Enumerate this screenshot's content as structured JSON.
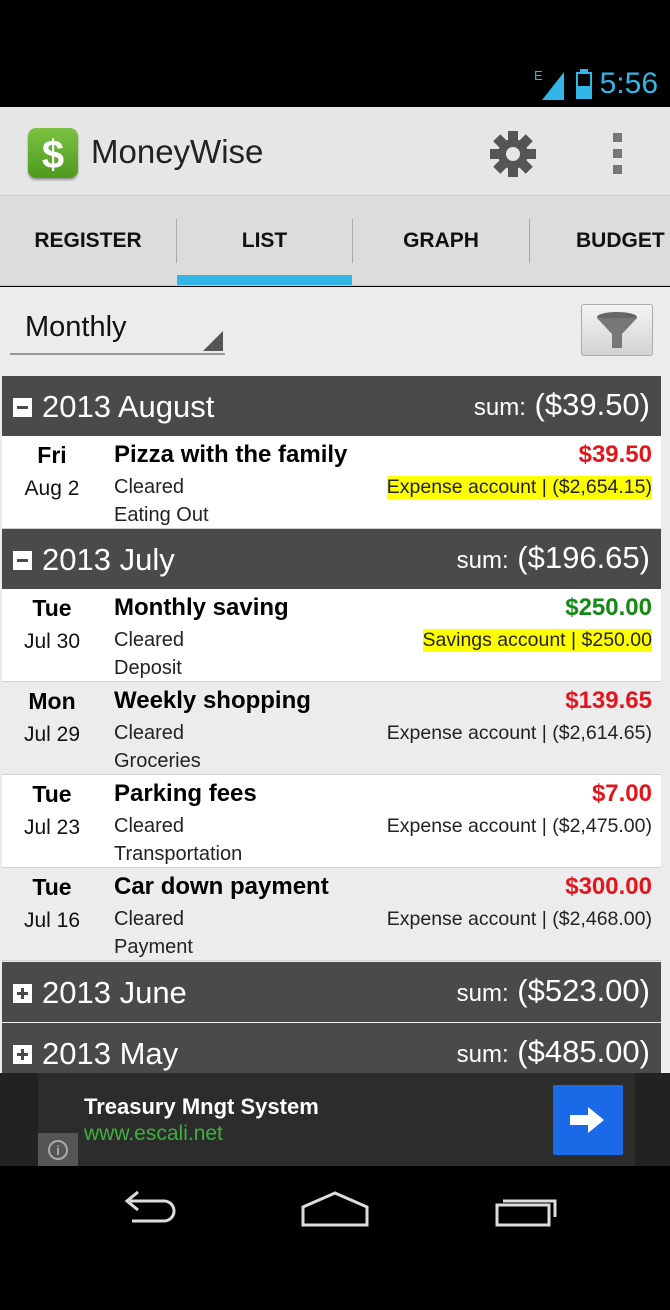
{
  "status_bar": {
    "network_type": "E",
    "time": "5:56"
  },
  "action_bar": {
    "app_title": "MoneyWise",
    "logo_glyph": "$"
  },
  "tabs": [
    {
      "label": "REGISTER",
      "selected": false
    },
    {
      "label": "LIST",
      "selected": true
    },
    {
      "label": "GRAPH",
      "selected": false
    },
    {
      "label": "BUDGET",
      "selected": false
    }
  ],
  "filter": {
    "period": "Monthly"
  },
  "groups": [
    {
      "title": "2013 August",
      "sum_label": "sum:",
      "sum": "($39.50)",
      "expanded": true,
      "transactions": [
        {
          "day": "Fri",
          "date": "Aug 2",
          "title": "Pizza with the family",
          "status": "Cleared",
          "category": "Eating Out",
          "amount": "$39.50",
          "amount_color": "#e4161d",
          "account": "Expense account | ($2,654.15)",
          "highlighted": true
        }
      ]
    },
    {
      "title": "2013 July",
      "sum_label": "sum:",
      "sum": "($196.65)",
      "expanded": true,
      "transactions": [
        {
          "day": "Tue",
          "date": "Jul 30",
          "title": "Monthly saving",
          "status": "Cleared",
          "category": "Deposit",
          "amount": "$250.00",
          "amount_color": "#138a13",
          "account": "Savings account | $250.00",
          "highlighted": true
        },
        {
          "day": "Mon",
          "date": "Jul 29",
          "title": "Weekly shopping",
          "status": "Cleared",
          "category": "Groceries",
          "amount": "$139.65",
          "amount_color": "#e4161d",
          "account": "Expense account | ($2,614.65)",
          "highlighted": false
        },
        {
          "day": "Tue",
          "date": "Jul 23",
          "title": "Parking fees",
          "status": "Cleared",
          "category": "Transportation",
          "amount": "$7.00",
          "amount_color": "#e4161d",
          "account": "Expense account | ($2,475.00)",
          "highlighted": false
        },
        {
          "day": "Tue",
          "date": "Jul 16",
          "title": "Car down payment",
          "status": "Cleared",
          "category": "Payment",
          "amount": "$300.00",
          "amount_color": "#e4161d",
          "account": "Expense account | ($2,468.00)",
          "highlighted": false
        }
      ]
    },
    {
      "title": "2013 June",
      "sum_label": "sum:",
      "sum": "($523.00)",
      "expanded": false,
      "transactions": []
    },
    {
      "title": "2013 May",
      "sum_label": "sum:",
      "sum": "($485.00)",
      "expanded": false,
      "transactions": []
    }
  ],
  "ad": {
    "title": "Treasury Mngt System",
    "url": "www.escali.net",
    "info_glyph": "i"
  },
  "icons": {
    "settings": "gear-icon",
    "overflow": "overflow-menu-icon",
    "filter": "filter-funnel-icon",
    "back": "back-icon",
    "home": "home-icon",
    "recents": "recent-apps-icon",
    "ad_go": "arrow-right-icon"
  },
  "colors": {
    "accent": "#33b5e5",
    "expense": "#e4161d",
    "income": "#138a13",
    "highlight": "#ffff00",
    "group_header": "#4a4a4a"
  }
}
